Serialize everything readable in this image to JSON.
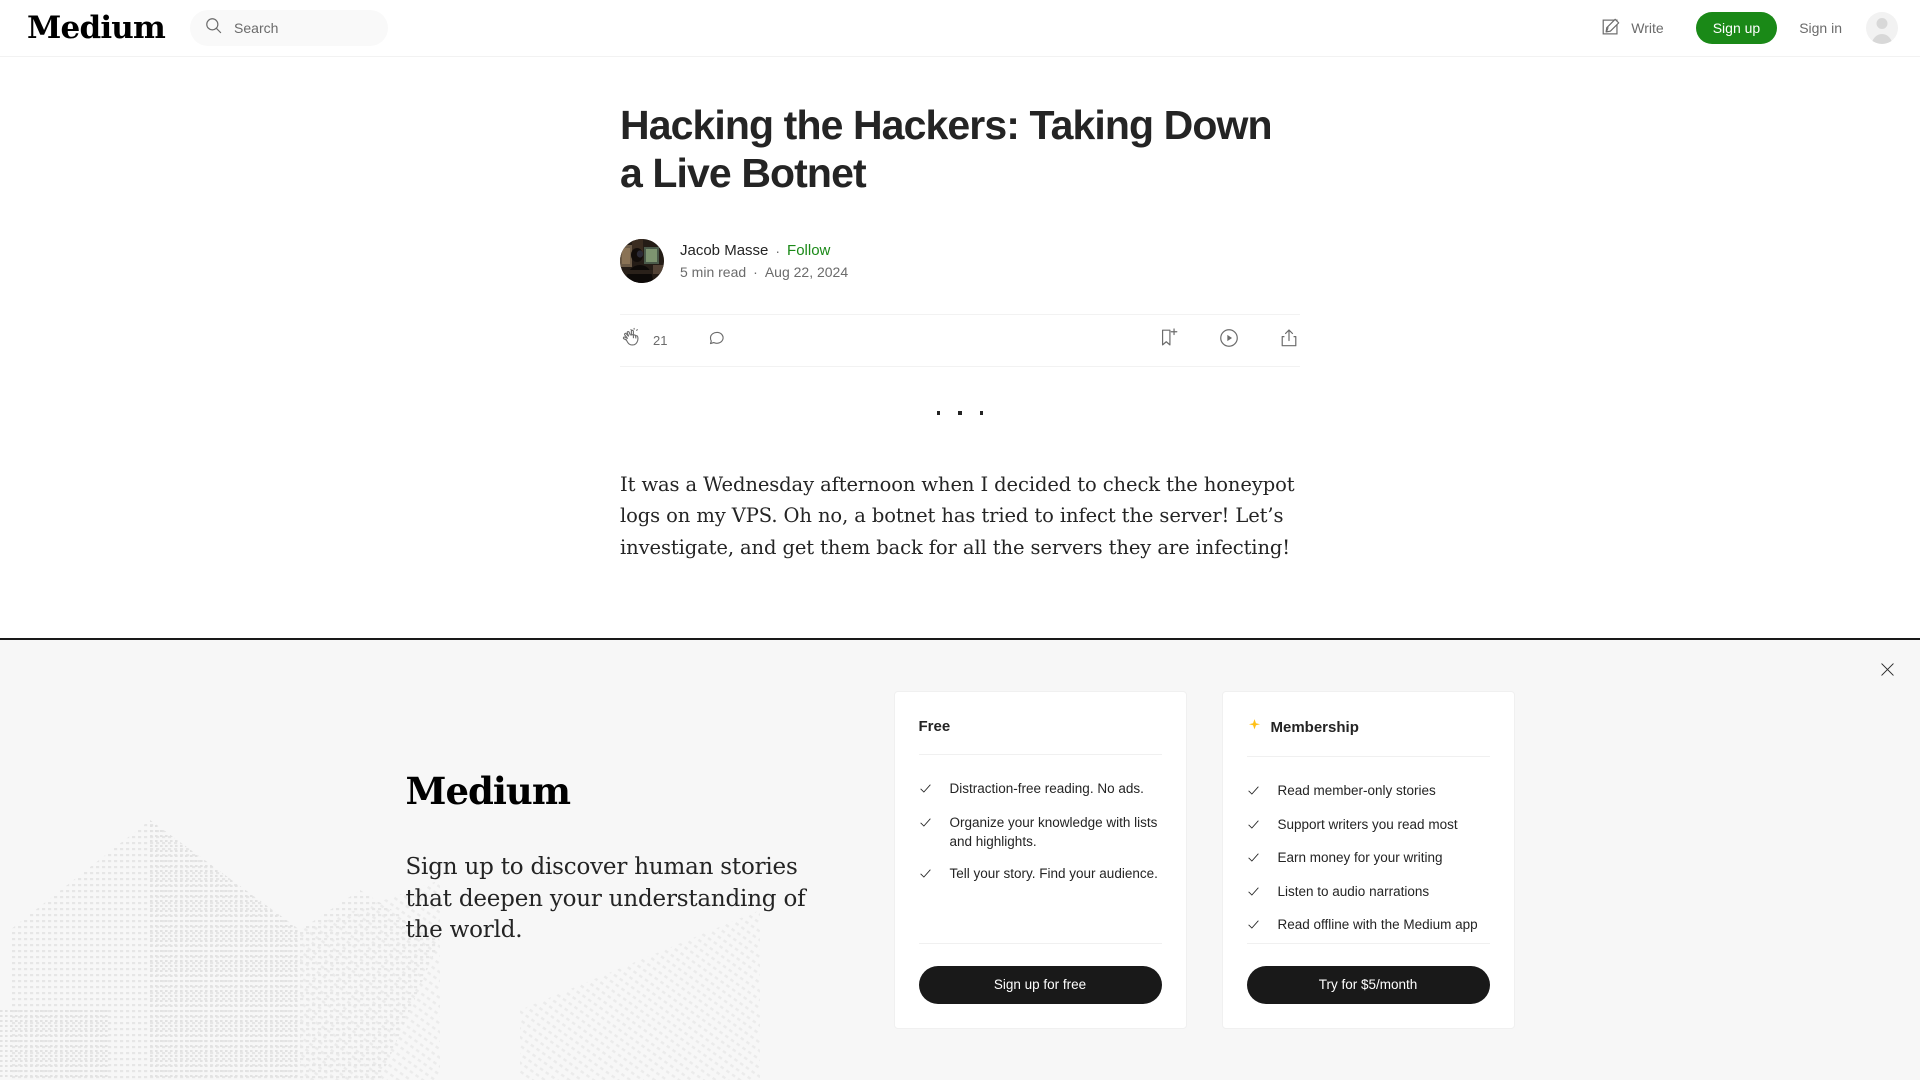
{
  "header": {
    "brand": "Medium",
    "search": {
      "placeholder": "Search",
      "value": "",
      "icon": "search-icon"
    },
    "write_label": "Write",
    "write_icon": "pencil-square-icon",
    "signup_label": "Sign up",
    "signin_label": "Sign in",
    "avatar_icon": "user-avatar-placeholder-icon",
    "accent_green": "#1a8917"
  },
  "article": {
    "title": "Hacking the Hackers: Taking Down a Live Botnet",
    "author": "Jacob Masse",
    "separator": "·",
    "follow_label": "Follow",
    "read_time": "5 min read",
    "date": "Aug 22, 2024",
    "actions": {
      "clap_icon": "clap-icon",
      "clap_count": "21",
      "comment_icon": "comment-icon",
      "bookmark_icon": "bookmark-plus-icon",
      "listen_icon": "play-circle-icon",
      "share_icon": "share-icon"
    },
    "divider": "· · ·",
    "paragraph": "It was a Wednesday afternoon when I decided to check the honeypot logs on my VPS. Oh no, a botnet has tried to infect the server! Let’s investigate, and get them back for all the servers they are infecting!"
  },
  "banner": {
    "close_icon": "close-icon",
    "logo": "Medium",
    "headline": "Sign up to discover human stories that deepen your understanding of the world.",
    "background_art": "halftone-ascii-geometry",
    "cards": [
      {
        "title": "Free",
        "icon": null,
        "features": [
          "Distraction-free reading. No ads.",
          "Organize your knowledge with lists and highlights.",
          "Tell your story. Find your audience."
        ],
        "cta": "Sign up for free"
      },
      {
        "title": "Membership",
        "icon": "star-icon",
        "icon_color": "#ffc017",
        "features": [
          "Read member-only stories",
          "Support writers you read most",
          "Earn money for your writing",
          "Listen to audio narrations",
          "Read offline with the Medium app"
        ],
        "cta": "Try for $5/month"
      }
    ]
  }
}
